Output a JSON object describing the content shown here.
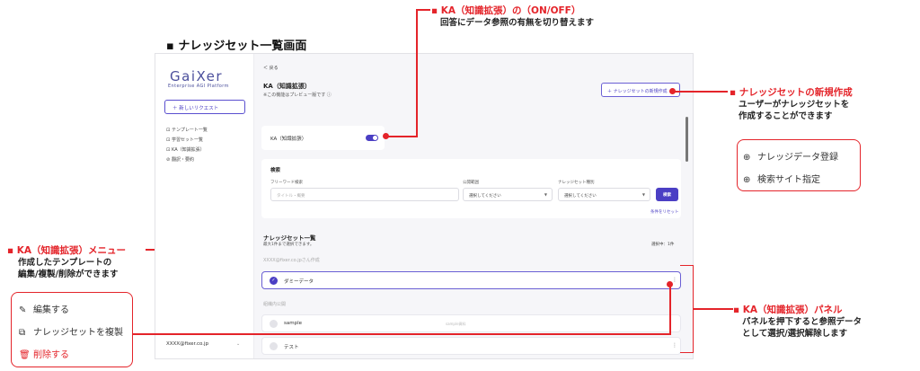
{
  "page": {
    "title": "▪ ナレッジセット一覧画面"
  },
  "sidebar": {
    "logo": "GaiXer",
    "logo_sub": "Enterprise AGI Platform",
    "new_request": "＋ 新しいリクエスト",
    "items": [
      {
        "icon": "template-icon",
        "glyph": "⊡",
        "label": "テンプレート一覧"
      },
      {
        "icon": "learning-set-icon",
        "glyph": "⊡",
        "label": "学習セット一覧"
      },
      {
        "icon": "ka-icon",
        "glyph": "⊡",
        "label": "KA（知識拡張）"
      },
      {
        "icon": "translate-icon",
        "glyph": "⊘",
        "label": "翻訳・要約"
      }
    ],
    "user": "XXXX@fixer.co.jp",
    "user_chevron": "⌄"
  },
  "main": {
    "back": "＜ 戻る",
    "title": "KA（知識拡張）",
    "note": "※この機能はプレビュー版です ⓘ",
    "create_button": "＋ ナレッジセットの新規作成",
    "toggle_label": "KA（知識拡張）",
    "toggle_on": true,
    "search": {
      "heading": "検索",
      "freeword_label": "フリーワード検索",
      "freeword_placeholder": "タイトル・概要",
      "scope_label": "公開範囲",
      "scope_value": "選択してください",
      "type_label": "ナレッジセット種別",
      "type_value": "選択してください",
      "search_button": "検索",
      "reset": "条件をリセット"
    },
    "list": {
      "title": "ナレッジセット一覧",
      "sub": "最大1件まで選択できます。",
      "selected": "選択中：1件",
      "groups": [
        {
          "label": "XXXX@fixer.co.jpさん作成",
          "rows": [
            {
              "name": "ダミーデータ",
              "meta": "",
              "selected": true
            }
          ]
        },
        {
          "label": "組織内公開",
          "rows": [
            {
              "name": "sample",
              "meta": "sample資料",
              "selected": false
            },
            {
              "name": "テスト",
              "meta": "",
              "selected": false
            }
          ]
        }
      ]
    }
  },
  "annotations": {
    "ka_toggle": {
      "title": "▪ KA（知識拡張）の（ON/OFF）",
      "body": "回答にデータ参照の有無を切り替えます"
    },
    "create": {
      "title": "▪ ナレッジセットの新規作成",
      "body1": "ユーザーがナレッジセットを",
      "body2": "作成することができます"
    },
    "create_menu": [
      {
        "icon": "plus-circle-icon",
        "glyph": "⊕",
        "label": "ナレッジデータ登録"
      },
      {
        "icon": "globe-icon",
        "glyph": "⊕",
        "label": "検索サイト指定"
      }
    ],
    "ka_menu": {
      "title": "▪ KA（知識拡張）メニュー",
      "body1": "作成したテンプレートの",
      "body2": "編集/複製/削除ができます"
    },
    "ka_menu_items": [
      {
        "icon": "edit-icon",
        "glyph": "✎",
        "label": "編集する",
        "danger": false
      },
      {
        "icon": "copy-icon",
        "glyph": "⧉",
        "label": "ナレッジセットを複製",
        "danger": false
      },
      {
        "icon": "trash-icon",
        "glyph": "🗑",
        "label": "削除する",
        "danger": true
      }
    ],
    "ka_panel": {
      "title": "▪ KA（知識拡張）パネル",
      "body1": "パネルを押下すると参照データ",
      "body2": "として選択/選択解除します"
    }
  }
}
